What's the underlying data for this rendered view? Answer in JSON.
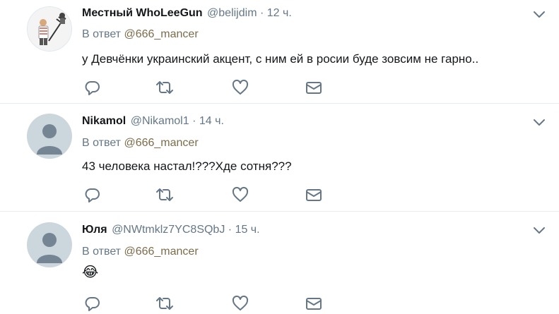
{
  "tweets": [
    {
      "name": "Местный WhoLeeGun",
      "handle": "@belijdim",
      "separator": "·",
      "time": "12 ч.",
      "reply_prefix": "В ответ",
      "reply_to": "@666_mancer",
      "text": "у Девчёнки украинский акцент, с ним ей в росии буде зовсим не гарно..",
      "avatar": "custom-avatar"
    },
    {
      "name": "Nikamol",
      "handle": "@Nikamol1",
      "separator": "·",
      "time": "14 ч.",
      "reply_prefix": "В ответ",
      "reply_to": "@666_mancer",
      "text": "43 человека настал!???Хде сотня???",
      "avatar": "default-avatar"
    },
    {
      "name": "Юля",
      "handle": "@NWtmklz7YC8SQbJ",
      "separator": "·",
      "time": "15 ч.",
      "reply_prefix": "В ответ",
      "reply_to": "@666_mancer",
      "text": "😂",
      "avatar": "default-avatar"
    }
  ],
  "icons": {
    "reply": "reply-icon",
    "retweet": "retweet-icon",
    "like": "heart-icon",
    "message": "envelope-icon",
    "menu": "chevron-down-icon"
  },
  "colors": {
    "name": "#14171a",
    "secondary": "#657786",
    "mention": "#7b6c4a",
    "icon": "#657786",
    "divider": "#e6ecf0",
    "default_avatar": "#ccd6dd"
  }
}
